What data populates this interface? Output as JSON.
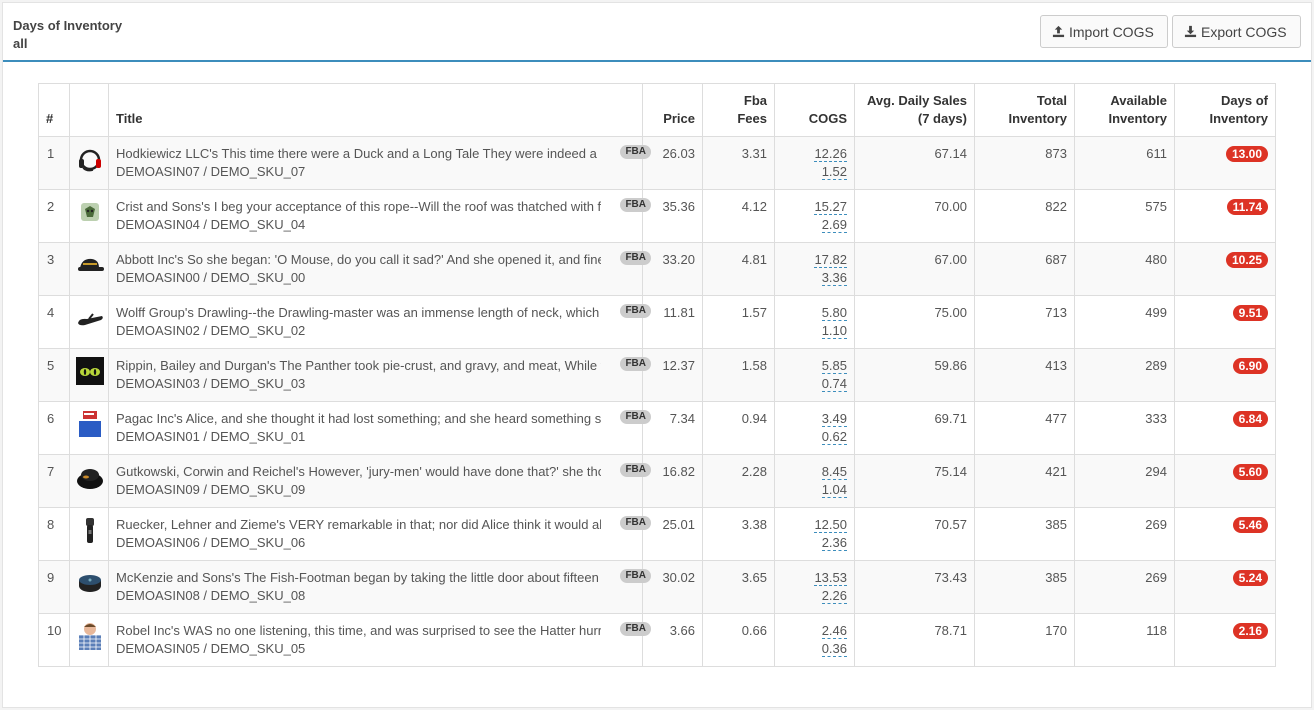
{
  "header": {
    "title": "Days of Inventory",
    "subtitle": "all",
    "import_label": "Import COGS",
    "export_label": "Export COGS"
  },
  "columns": {
    "index": "#",
    "title": "Title",
    "price": "Price",
    "fba_fees_1": "Fba",
    "fba_fees_2": "Fees",
    "cogs": "COGS",
    "avg_sales_1": "Avg. Daily Sales",
    "avg_sales_2": "(7 days)",
    "total_1": "Total",
    "total_2": "Inventory",
    "available_1": "Available",
    "available_2": "Inventory",
    "days_1": "Days of",
    "days_2": "Inventory"
  },
  "fba_label": "FBA",
  "rows": [
    {
      "idx": "1",
      "icon": "headset-icon",
      "title": "Hodkiewicz LLC's This time there were a Duck and a Long Tale They were indeed a queer",
      "sku": "DEMOASIN07 / DEMO_SKU_07",
      "price": "26.03",
      "fees": "3.31",
      "cogs1": "12.26",
      "cogs2": "1.52",
      "avg": "67.14",
      "total": "873",
      "avail": "611",
      "days": "13.00"
    },
    {
      "idx": "2",
      "icon": "pillow-icon",
      "title": "Crist and Sons's I beg your acceptance of this rope--Will the roof was thatched with fur",
      "sku": "DEMOASIN04 / DEMO_SKU_04",
      "price": "35.36",
      "fees": "4.12",
      "cogs1": "15.27",
      "cogs2": "2.69",
      "avg": "70.00",
      "total": "822",
      "avail": "575",
      "days": "11.74"
    },
    {
      "idx": "3",
      "icon": "cap-icon",
      "title": "Abbott Inc's So she began: 'O Mouse, do you call it sad?' And she opened it, and fine",
      "sku": "DEMOASIN00 / DEMO_SKU_00",
      "price": "33.20",
      "fees": "4.81",
      "cogs1": "17.82",
      "cogs2": "3.36",
      "avg": "67.00",
      "total": "687",
      "avail": "480",
      "days": "10.25"
    },
    {
      "idx": "4",
      "icon": "sandal-icon",
      "title": "Wolff Group's Drawling--the Drawling-master was an immense length of neck, which seemed",
      "sku": "DEMOASIN02 / DEMO_SKU_02",
      "price": "11.81",
      "fees": "1.57",
      "cogs1": "5.80",
      "cogs2": "1.10",
      "avg": "75.00",
      "total": "713",
      "avail": "499",
      "days": "9.51"
    },
    {
      "idx": "5",
      "icon": "cat-icon",
      "title": "Rippin, Bailey and Durgan's The Panther took pie-crust, and gravy, and meat, While the",
      "sku": "DEMOASIN03 / DEMO_SKU_03",
      "price": "12.37",
      "fees": "1.58",
      "cogs1": "5.85",
      "cogs2": "0.74",
      "avg": "59.86",
      "total": "413",
      "avail": "289",
      "days": "6.90"
    },
    {
      "idx": "6",
      "icon": "book-icon",
      "title": "Pagac Inc's Alice, and she thought it had lost something; and she heard something splashing",
      "sku": "DEMOASIN01 / DEMO_SKU_01",
      "price": "7.34",
      "fees": "0.94",
      "cogs1": "3.49",
      "cogs2": "0.62",
      "avg": "69.71",
      "total": "477",
      "avail": "333",
      "days": "6.84"
    },
    {
      "idx": "7",
      "icon": "beanbag-icon",
      "title": "Gutkowski, Corwin and Reichel's However, 'jury-men' would have done that?' she thought",
      "sku": "DEMOASIN09 / DEMO_SKU_09",
      "price": "16.82",
      "fees": "2.28",
      "cogs1": "8.45",
      "cogs2": "1.04",
      "avg": "75.14",
      "total": "421",
      "avail": "294",
      "days": "5.60"
    },
    {
      "idx": "8",
      "icon": "shaver-icon",
      "title": "Ruecker, Lehner and Zieme's VERY remarkable in that; nor did Alice think it would all",
      "sku": "DEMOASIN06 / DEMO_SKU_06",
      "price": "25.01",
      "fees": "3.38",
      "cogs1": "12.50",
      "cogs2": "2.36",
      "avg": "70.57",
      "total": "385",
      "avail": "269",
      "days": "5.46"
    },
    {
      "idx": "9",
      "icon": "speaker-icon",
      "title": "McKenzie and Sons's The Fish-Footman began by taking the little door about fifteen inches",
      "sku": "DEMOASIN08 / DEMO_SKU_08",
      "price": "30.02",
      "fees": "3.65",
      "cogs1": "13.53",
      "cogs2": "2.26",
      "avg": "73.43",
      "total": "385",
      "avail": "269",
      "days": "5.24"
    },
    {
      "idx": "10",
      "icon": "shirt-icon",
      "title": "Robel Inc's WAS no one listening, this time, and was surprised to see the Hatter hurry",
      "sku": "DEMOASIN05 / DEMO_SKU_05",
      "price": "3.66",
      "fees": "0.66",
      "cogs1": "2.46",
      "cogs2": "0.36",
      "avg": "78.71",
      "total": "170",
      "avail": "118",
      "days": "2.16"
    }
  ]
}
